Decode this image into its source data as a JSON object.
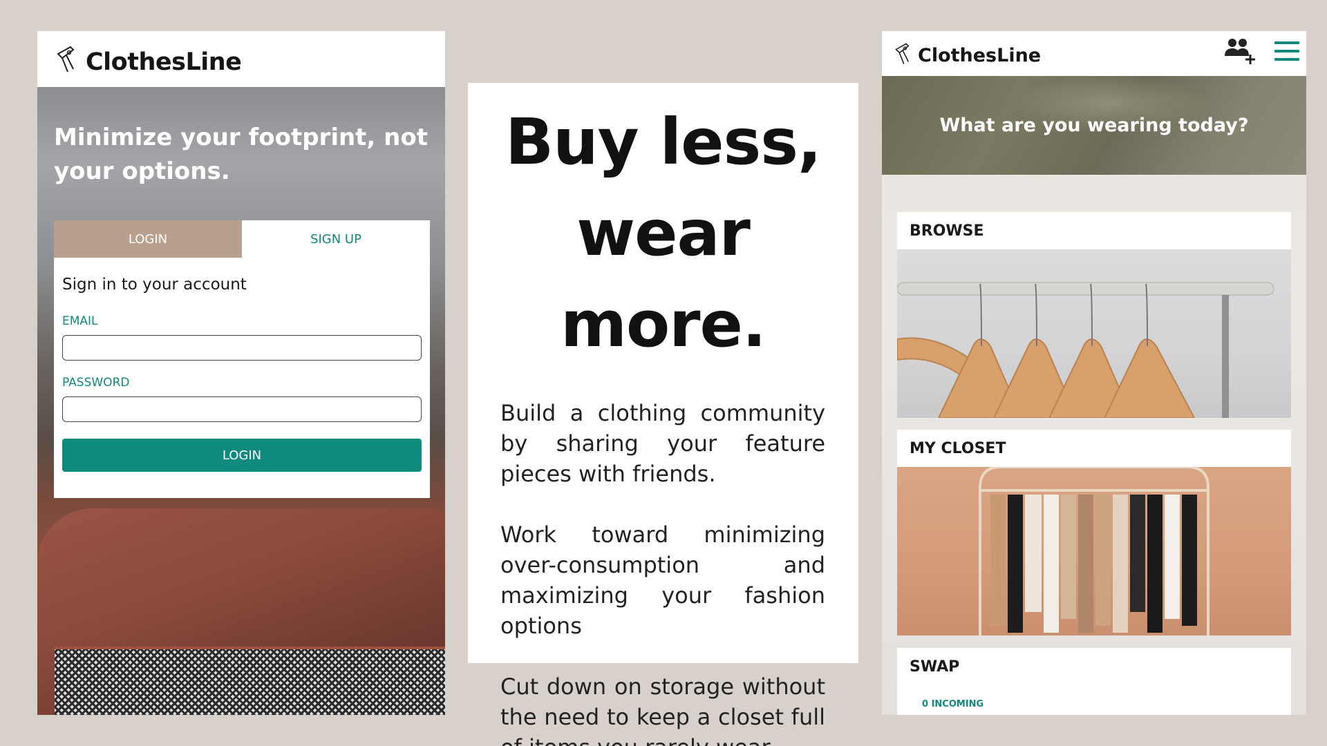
{
  "colors": {
    "accent": "#0f8a7d",
    "login_tab": "#b8a08d",
    "background": "#d8d1cb"
  },
  "login_screen": {
    "brand": "ClothesLine",
    "tagline": "Minimize your footprint, not your options.",
    "tabs": {
      "login": "LOGIN",
      "signup": "SIGN UP"
    },
    "card_title": "Sign in to your account",
    "email_label": "EMAIL",
    "email_value": "",
    "password_label": "PASSWORD",
    "password_value": "",
    "submit_label": "LOGIN"
  },
  "promo": {
    "headline_line1": "Buy less,",
    "headline_line2": "wear more.",
    "paragraphs": [
      "Build a clothing community by sharing your feature pieces with friends.",
      "Work toward minimizing over-consumption and maximizing your fashion options",
      "Cut down on storage without the need to keep a closet full of items you rarely wear."
    ]
  },
  "dashboard": {
    "brand": "ClothesLine",
    "icons": [
      "add-friend-icon",
      "hamburger-menu-icon"
    ],
    "banner": "What are you wearing today?",
    "sections": {
      "browse": "BROWSE",
      "closet": "MY CLOSET",
      "swap": "SWAP"
    },
    "swap_incoming": "0 INCOMING"
  }
}
